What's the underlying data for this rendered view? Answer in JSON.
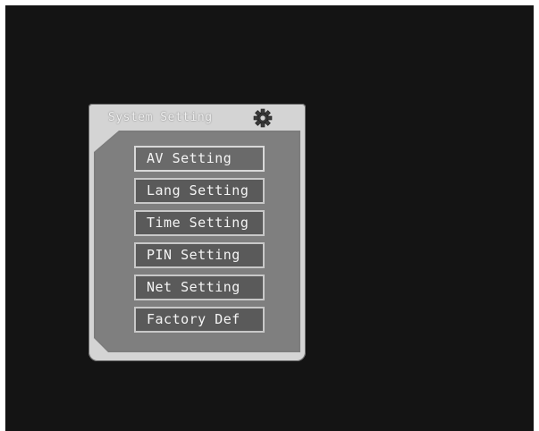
{
  "menu": {
    "title": "System Setting",
    "icon": "gear-icon",
    "items": [
      {
        "label": "AV Setting"
      },
      {
        "label": "Lang Setting"
      },
      {
        "label": "Time Setting"
      },
      {
        "label": "PIN Setting"
      },
      {
        "label": "Net Setting"
      },
      {
        "label": "Factory Def"
      }
    ]
  },
  "colors": {
    "screen_background": "#141414",
    "panel_background": "#d4d4d4",
    "panel_body": "#7f7f7f",
    "button_fill": "#5a5a5a",
    "button_border": "#c8c8c8",
    "text": "#f4f4f4"
  }
}
